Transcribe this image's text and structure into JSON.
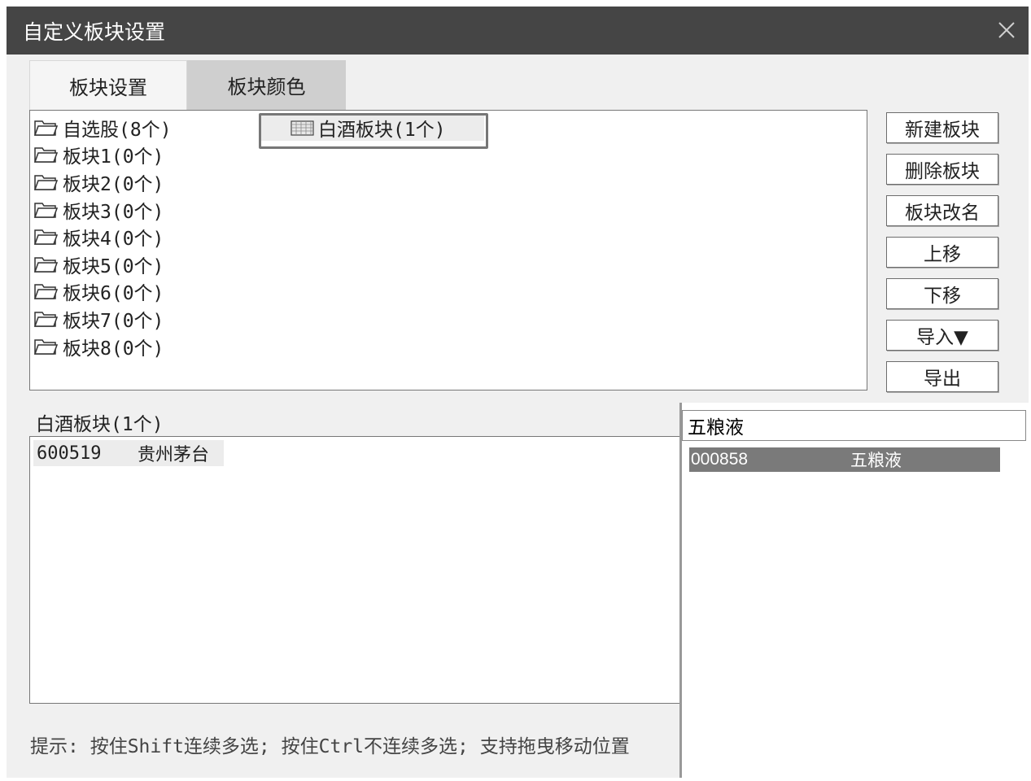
{
  "window": {
    "title": "自定义板块设置"
  },
  "tabs": [
    {
      "label": "板块设置",
      "active": true
    },
    {
      "label": "板块颜色",
      "active": false
    }
  ],
  "groups": [
    {
      "label": "自选股(8个)"
    },
    {
      "label": "板块1(0个)"
    },
    {
      "label": "板块2(0个)"
    },
    {
      "label": "板块3(0个)"
    },
    {
      "label": "板块4(0个)"
    },
    {
      "label": "板块5(0个)"
    },
    {
      "label": "板块6(0个)"
    },
    {
      "label": "板块7(0个)"
    },
    {
      "label": "板块8(0个)"
    }
  ],
  "selected_block": {
    "label": "白酒板块(1个)"
  },
  "buttons": {
    "new_block": "新建板块",
    "delete_block": "删除板块",
    "rename_block": "板块改名",
    "move_up": "上移",
    "move_down": "下移",
    "import": "导入▼",
    "export": "导出"
  },
  "stock_list": {
    "header": "白酒板块(1个)",
    "rows": [
      {
        "code": "600519",
        "name": "贵州茅台"
      }
    ]
  },
  "search": {
    "value": "五粮液",
    "results": [
      {
        "code": "000858",
        "name": "五粮液"
      }
    ]
  },
  "tip": "提示: 按住Shift连续多选; 按住Ctrl不连续多选; 支持拖曳移动位置",
  "colors": {
    "titlebar": "#454545",
    "dialog_bg": "#f0f0f0",
    "selected_row": "#7a7a7a",
    "highlight_border": "#777777"
  },
  "icons": {
    "close": "close-icon",
    "folder": "folder-icon",
    "block": "grid-icon"
  }
}
